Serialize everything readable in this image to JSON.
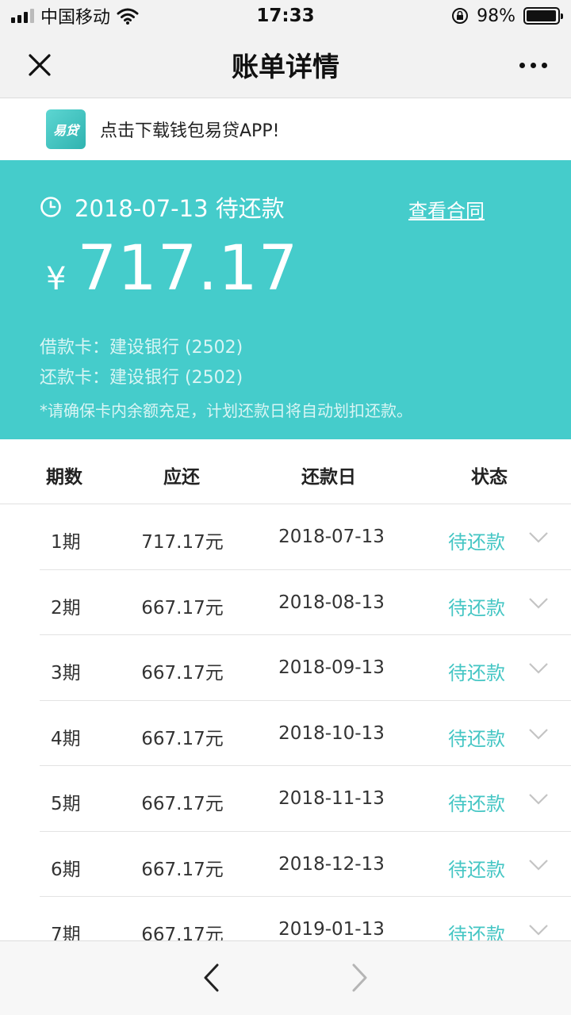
{
  "status_bar": {
    "carrier": "中国移动",
    "time": "17:33",
    "battery": "98%",
    "battery_level": 0.98
  },
  "nav": {
    "title": "账单详情"
  },
  "banner": {
    "logo_text": "易贷",
    "text": "点击下载钱包易贷APP!"
  },
  "summary": {
    "due_text": "2018-07-13 待还款",
    "contract_link": "查看合同",
    "currency": "¥",
    "amount": "717.17",
    "loan_card": "借款卡：建设银行 (2502)",
    "repay_card": "还款卡：建设银行 (2502)",
    "notice": "*请确保卡内余额充足，计划还款日将自动划扣还款。"
  },
  "table": {
    "headers": [
      "期数",
      "应还",
      "还款日",
      "状态"
    ],
    "rows": [
      {
        "period": "1期",
        "amount": "717.17元",
        "date": "2018-07-13",
        "status": "待还款"
      },
      {
        "period": "2期",
        "amount": "667.17元",
        "date": "2018-08-13",
        "status": "待还款"
      },
      {
        "period": "3期",
        "amount": "667.17元",
        "date": "2018-09-13",
        "status": "待还款"
      },
      {
        "period": "4期",
        "amount": "667.17元",
        "date": "2018-10-13",
        "status": "待还款"
      },
      {
        "period": "5期",
        "amount": "667.17元",
        "date": "2018-11-13",
        "status": "待还款"
      },
      {
        "period": "6期",
        "amount": "667.17元",
        "date": "2018-12-13",
        "status": "待还款"
      },
      {
        "period": "7期",
        "amount": "667.17元",
        "date": "2019-01-13",
        "status": "待还款"
      }
    ]
  },
  "colors": {
    "accent": "#45cccb",
    "status_text": "#45c6c4"
  }
}
